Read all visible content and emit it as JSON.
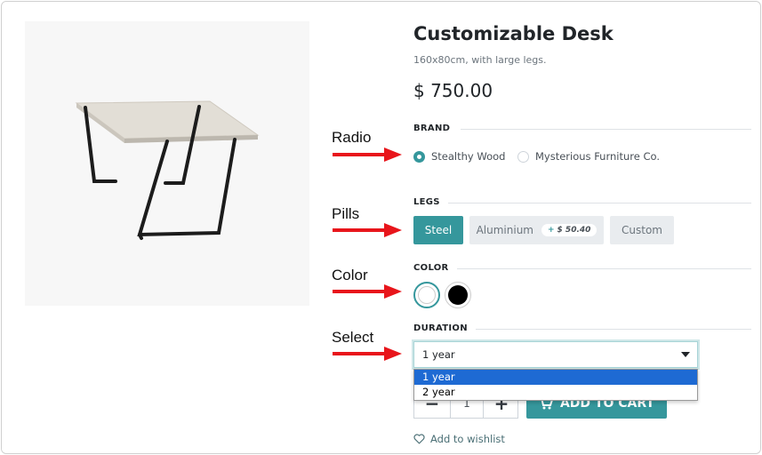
{
  "product": {
    "title": "Customizable Desk",
    "description": "160x80cm, with large legs.",
    "price": "$ 750.00"
  },
  "callouts": {
    "radio": "Radio",
    "pills": "Pills",
    "color": "Color",
    "select": "Select"
  },
  "brand": {
    "label": "BRAND",
    "options": [
      {
        "label": "Stealthy Wood",
        "checked": true
      },
      {
        "label": "Mysterious Furniture Co.",
        "checked": false
      }
    ]
  },
  "legs": {
    "label": "LEGS",
    "options": [
      {
        "label": "Steel",
        "active": true
      },
      {
        "label": "Aluminium",
        "active": false,
        "extra": "$ 50.40"
      },
      {
        "label": "Custom",
        "active": false
      }
    ]
  },
  "color": {
    "label": "COLOR",
    "swatches": [
      {
        "name": "white",
        "hex": "#ffffff",
        "selected": true
      },
      {
        "name": "black",
        "hex": "#000000",
        "selected": false
      }
    ]
  },
  "duration": {
    "label": "DURATION",
    "value": "1 year",
    "options": [
      {
        "label": "1 year",
        "selected": true
      },
      {
        "label": "2 year",
        "selected": false
      }
    ]
  },
  "quantity": {
    "value": "1",
    "minus": "−",
    "plus": "+"
  },
  "cart": {
    "label": "ADD TO CART"
  },
  "wishlist": {
    "label": "Add to wishlist"
  },
  "colors": {
    "accent": "#35979c",
    "arrow": "#e8151b",
    "dropdown_highlight": "#1e6ad3"
  },
  "icons": [
    "radio-icon",
    "cart-icon",
    "heart-icon",
    "caret-down-icon",
    "arrow-right-icon"
  ]
}
